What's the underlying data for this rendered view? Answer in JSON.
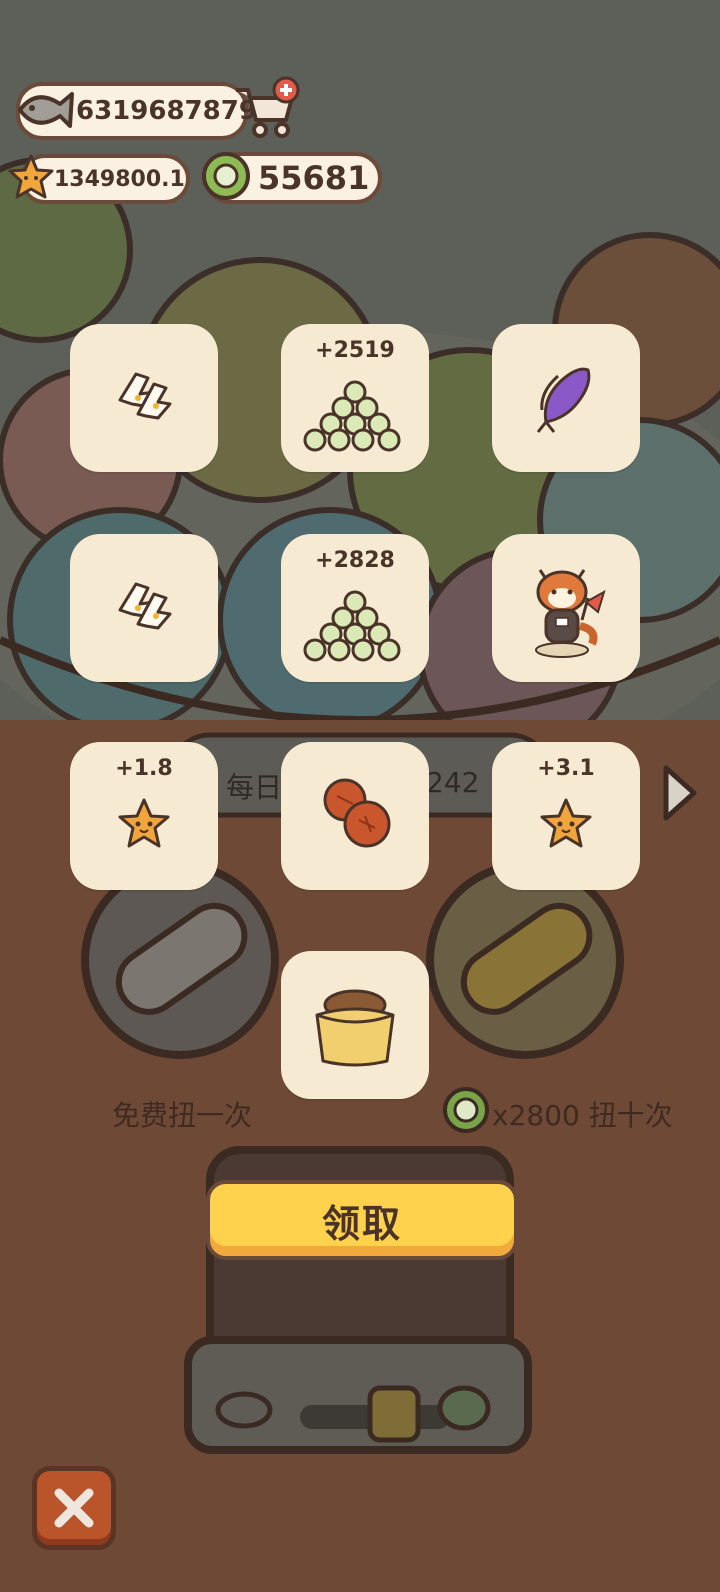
{
  "currencies": {
    "fish": "6319687879",
    "stars": "1349800.1",
    "coins": "55681"
  },
  "rewards": [
    {
      "amount": "",
      "icon": "fish-bones-icon"
    },
    {
      "amount": "+2519",
      "icon": "coin-pile-icon"
    },
    {
      "amount": "",
      "icon": "purple-fish-icon"
    },
    {
      "amount": "",
      "icon": "fish-bones-icon"
    },
    {
      "amount": "+2828",
      "icon": "coin-pile-icon"
    },
    {
      "amount": "",
      "icon": "red-panda-icon"
    },
    {
      "amount": "+1.8",
      "icon": "star-icon"
    },
    {
      "amount": "",
      "icon": "red-balls-icon"
    },
    {
      "amount": "+3.1",
      "icon": "star-icon"
    },
    {
      "amount": "",
      "icon": "sack-icon"
    }
  ],
  "machine": {
    "daily_left": "每日",
    "daily_right": "242",
    "free_once": "免费扭一次",
    "ten_cost": "x2800 扭十次"
  },
  "buttons": {
    "claim": "领取"
  },
  "colors": {
    "tile": "#f6ebd2",
    "claim": "#ffd24d",
    "close": "#b9542b",
    "outline": "#6b4a3a"
  }
}
